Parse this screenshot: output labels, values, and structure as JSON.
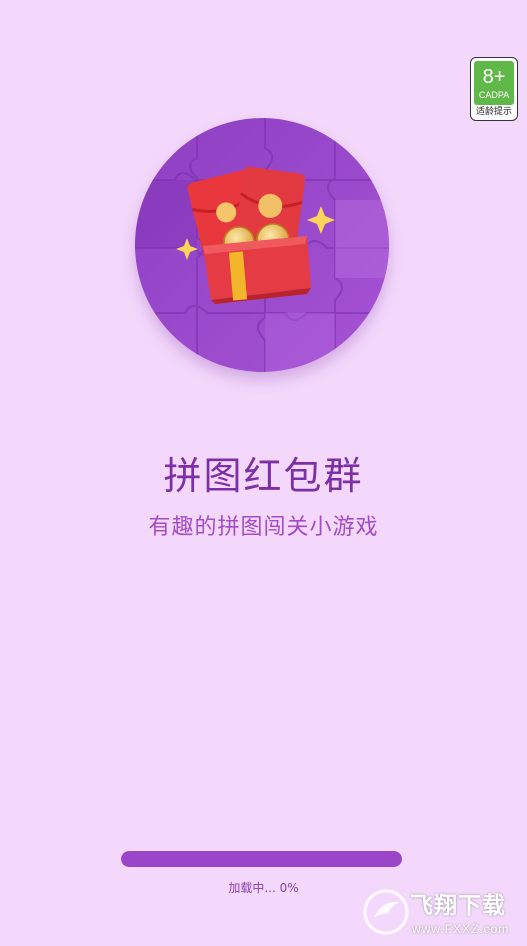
{
  "age_rating": {
    "age": "8+",
    "org": "CADPA",
    "hint": "适龄提示"
  },
  "app": {
    "title": "拼图红包群",
    "subtitle": "有趣的拼图闯关小游戏"
  },
  "loading": {
    "text": "加载中... 0%",
    "progress": 1.0
  },
  "watermark": {
    "text": "飞翔下载",
    "sub": "www.FXXZ.com"
  },
  "colors": {
    "background": "#f3d8fb",
    "title": "#7d2fa5",
    "subtitle": "#a54cc5",
    "progress_fill": "#9b45c9",
    "badge_green": "#5fb847"
  },
  "icons": {
    "hero": "red-envelope-gift-box-icon",
    "watermark_logo": "bird-logo-icon"
  }
}
